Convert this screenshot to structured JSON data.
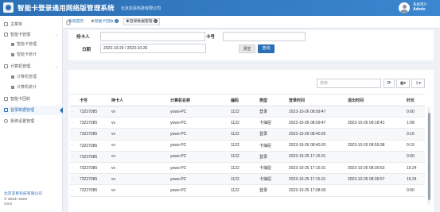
{
  "header": {
    "title": "智能卡登录通用网络版管理系统",
    "company": "北京友民科技有限公司",
    "user_role": "系统用户",
    "user_name": "Admin"
  },
  "sidebar": {
    "items": [
      {
        "label": "主菜单",
        "icon": "menu-icon"
      },
      {
        "label": "智能卡管理",
        "icon": "card-icon"
      },
      {
        "label": "智能卡管理",
        "icon": "grid-icon"
      },
      {
        "label": "智能卡统计",
        "icon": "grid-icon"
      },
      {
        "label": "计算机管理",
        "icon": "computer-icon"
      },
      {
        "label": "计算机管理",
        "icon": "grid-icon"
      },
      {
        "label": "计算机统计",
        "icon": "grid-icon"
      },
      {
        "label": "智能卡回收",
        "icon": "recycle-icon"
      },
      {
        "label": "登录数据管理",
        "icon": "data-icon"
      },
      {
        "label": "系统设置管理",
        "icon": "settings-icon"
      }
    ],
    "footer_brand": "北京友民科技有限公司",
    "footer_copyright": "© 2023~2023",
    "footer_version": "V3.0"
  },
  "tabs": [
    {
      "label": "系统首页"
    },
    {
      "label": "智能卡回收"
    },
    {
      "label": "登录数据管理"
    }
  ],
  "filter": {
    "holder_label": "持卡人",
    "holder_value": "",
    "card_label": "卡号",
    "card_value": "",
    "date_label": "日期",
    "date_value": "2023-10-20 / 2023-10-26",
    "clear_button": "清空",
    "query_button": "查询"
  },
  "toolbar": {
    "search_placeholder": "搜索",
    "refresh_glyph": "⟳",
    "columns_glyph": "▦▾",
    "export_glyph": "⇩▾"
  },
  "table": {
    "columns": [
      "卡号",
      "持卡人",
      "计算机名称",
      "编码",
      "类型",
      "登录时间",
      "退出时间",
      "时长"
    ],
    "rows": [
      [
        "73227085　",
        "vv",
        "yowo-PC",
        "1122",
        "登录",
        "2023-10-26 08:09:47",
        "",
        "0:00"
      ],
      [
        "73227085　",
        "vv",
        "yowo-PC",
        "1122",
        "卡抽屉",
        "2023-10-26 08:09:47",
        "2023-10-26 09:18:41",
        "1:08"
      ],
      [
        "73227085　",
        "vv",
        "yowo-PC",
        "1122",
        "登录",
        "2023-10-26 08:40:20",
        "",
        "0:16"
      ],
      [
        "73227085　",
        "vv",
        "yowo-PC",
        "1122",
        "卡抽屉",
        "2023-10-26 08:40:20",
        "2023-10-26 08:59:38",
        "0:19"
      ],
      [
        "73227085　",
        "vv",
        "yowo-PC",
        "1122",
        "登录",
        "2023-10-25 17:15:31",
        "",
        "0:00"
      ],
      [
        "73227085　",
        "vv",
        "yowo-PC",
        "1122",
        "卡抽屉",
        "2023-10-25 17:15:31",
        "2023-10-26 08:39:53",
        "15:24"
      ],
      [
        "73227085　",
        "vv",
        "yowo-PC",
        "1122",
        "卡抽屉",
        "2023-10-25 17:15:31",
        "2023-10-26 08:39:57",
        "15:24"
      ],
      [
        "73227085　",
        "vv",
        "yowo-PC",
        "1122",
        "登录",
        "2023-10-25 17:08:30",
        "",
        "0:00"
      ]
    ]
  },
  "colors": {
    "brand": "#2c6fb4",
    "active_item": "#2c6fb4"
  }
}
